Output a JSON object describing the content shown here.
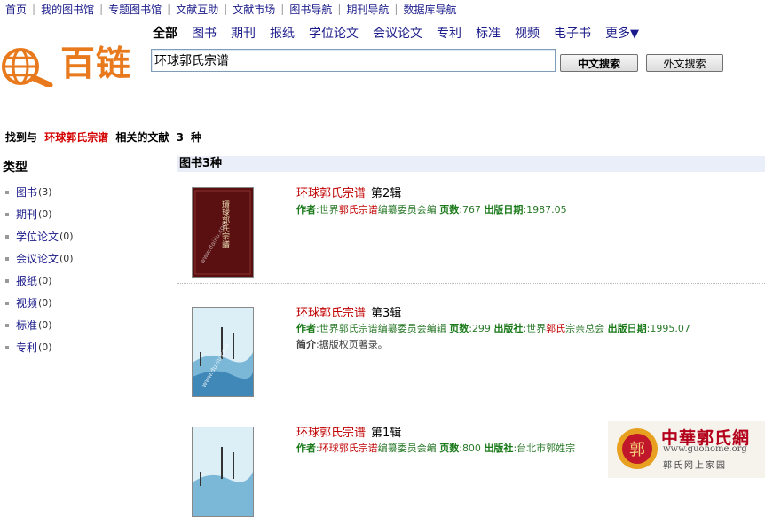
{
  "topnav": [
    "首页",
    "我的图书馆",
    "专题图书馆",
    "文献互助",
    "文献市场",
    "图书导航",
    "期刊导航",
    "数据库导航"
  ],
  "logo": {
    "text": "百链",
    "icon": "magnifier-globe-icon",
    "color": "#e8791c"
  },
  "categories": [
    "全部",
    "图书",
    "期刊",
    "报纸",
    "学位论文",
    "会议论文",
    "专利",
    "标准",
    "视频",
    "电子书"
  ],
  "more": {
    "label": "更多",
    "arrow": "▼"
  },
  "search": {
    "value": "环球郭氏宗谱",
    "btn_cn": "中文搜索",
    "btn_foreign": "外文搜索"
  },
  "summary": {
    "prefix": "找到与",
    "keyword": "环球郭氏宗谱",
    "middle": "相关的文献",
    "count": "3",
    "suffix": "种"
  },
  "sidebar": {
    "title": "类型",
    "items": [
      {
        "label": "图书",
        "count": "(3)"
      },
      {
        "label": "期刊",
        "count": "(0)"
      },
      {
        "label": "学位论文",
        "count": "(0)"
      },
      {
        "label": "会议论文",
        "count": "(0)"
      },
      {
        "label": "报纸",
        "count": "(0)"
      },
      {
        "label": "视频",
        "count": "(0)"
      },
      {
        "label": "标准",
        "count": "(0)"
      },
      {
        "label": "专利",
        "count": "(0)"
      }
    ]
  },
  "section": {
    "title": "图书3种"
  },
  "results": [
    {
      "title": "环球郭氏宗谱",
      "vol": "第2辑",
      "author_label": "作者",
      "author_pre": "世界",
      "author_hl": "郭氏宗谱",
      "author_post": "编纂委员会编",
      "pages_label": "页数",
      "pages": "767",
      "date_label": "出版日期",
      "date": "1987.05",
      "cover_text": "環球郭氏宗譜",
      "cover_watermark": "www.dailiu.com"
    },
    {
      "title": "环球郭氏宗谱",
      "vol": "第3辑",
      "author_label": "作者",
      "author_pre": "",
      "author_hl": "",
      "author_post": "世界郭氏宗谱编纂委员会编辑",
      "pages_label": "页数",
      "pages": "299",
      "publisher_label": "出版社",
      "publisher_pre": "世界",
      "publisher_hl": "郭氏",
      "publisher_post": "宗亲总会",
      "date_label": "出版日期",
      "date": "1995.07",
      "intro_label": "简介",
      "intro": "据版权页著录。",
      "cover_watermark": "www.duxiu.com"
    },
    {
      "title": "环球郭氏宗谱",
      "vol": "第1辑",
      "author_label": "作者",
      "author_pre": "",
      "author_hl": "环球郭氏宗谱",
      "author_post": "编纂委员会编",
      "pages_label": "页数",
      "pages": "800",
      "publisher_label": "出版社",
      "publisher_text": "台北市郭姓宗",
      "cover_watermark": "www.duxiu.com"
    }
  ],
  "watermark": {
    "title": "中華郭氏網",
    "url": "www.guohome.org",
    "sub": "郭氏网上家园",
    "seal": "郭"
  }
}
